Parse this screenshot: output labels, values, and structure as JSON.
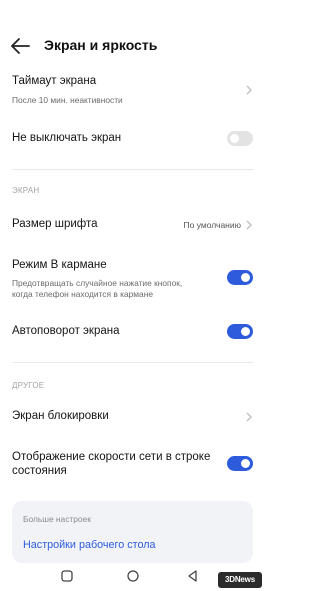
{
  "header": {
    "title": "Экран и яркость"
  },
  "rows": {
    "timeout": {
      "title": "Таймаут экрана",
      "subtitle": "После 10 мин. неактивности"
    },
    "keep_on": {
      "title": "Не выключать экран",
      "enabled": false
    },
    "font_size": {
      "title": "Размер шрифта",
      "value": "По умолчанию"
    },
    "pocket": {
      "title": "Режим В кармане",
      "subtitle_line1": "Предотвращать случайное нажатие кнопок,",
      "subtitle_line2": "когда телефон находится в кармане",
      "enabled": true
    },
    "autorotate": {
      "title": "Автоповорот экрана",
      "enabled": true
    },
    "lockscreen": {
      "title": "Экран блокировки"
    },
    "net_speed": {
      "title_line1": "Отображение скорости сети в строке",
      "title_line2": "состояния",
      "enabled": true
    }
  },
  "sections": {
    "screen": "ЭКРАН",
    "other": "ДРУГОЕ"
  },
  "more": {
    "title": "Больше настроек",
    "link": "Настройки рабочего стола"
  },
  "colors": {
    "accent": "#2d5bdc",
    "toggle_off": "#e3e3e3",
    "card_bg": "#f2f3f6"
  },
  "watermark": {
    "text": "3DNews"
  },
  "icons": {
    "back": "arrow-left-icon",
    "chevron": "chevron-right-icon"
  }
}
